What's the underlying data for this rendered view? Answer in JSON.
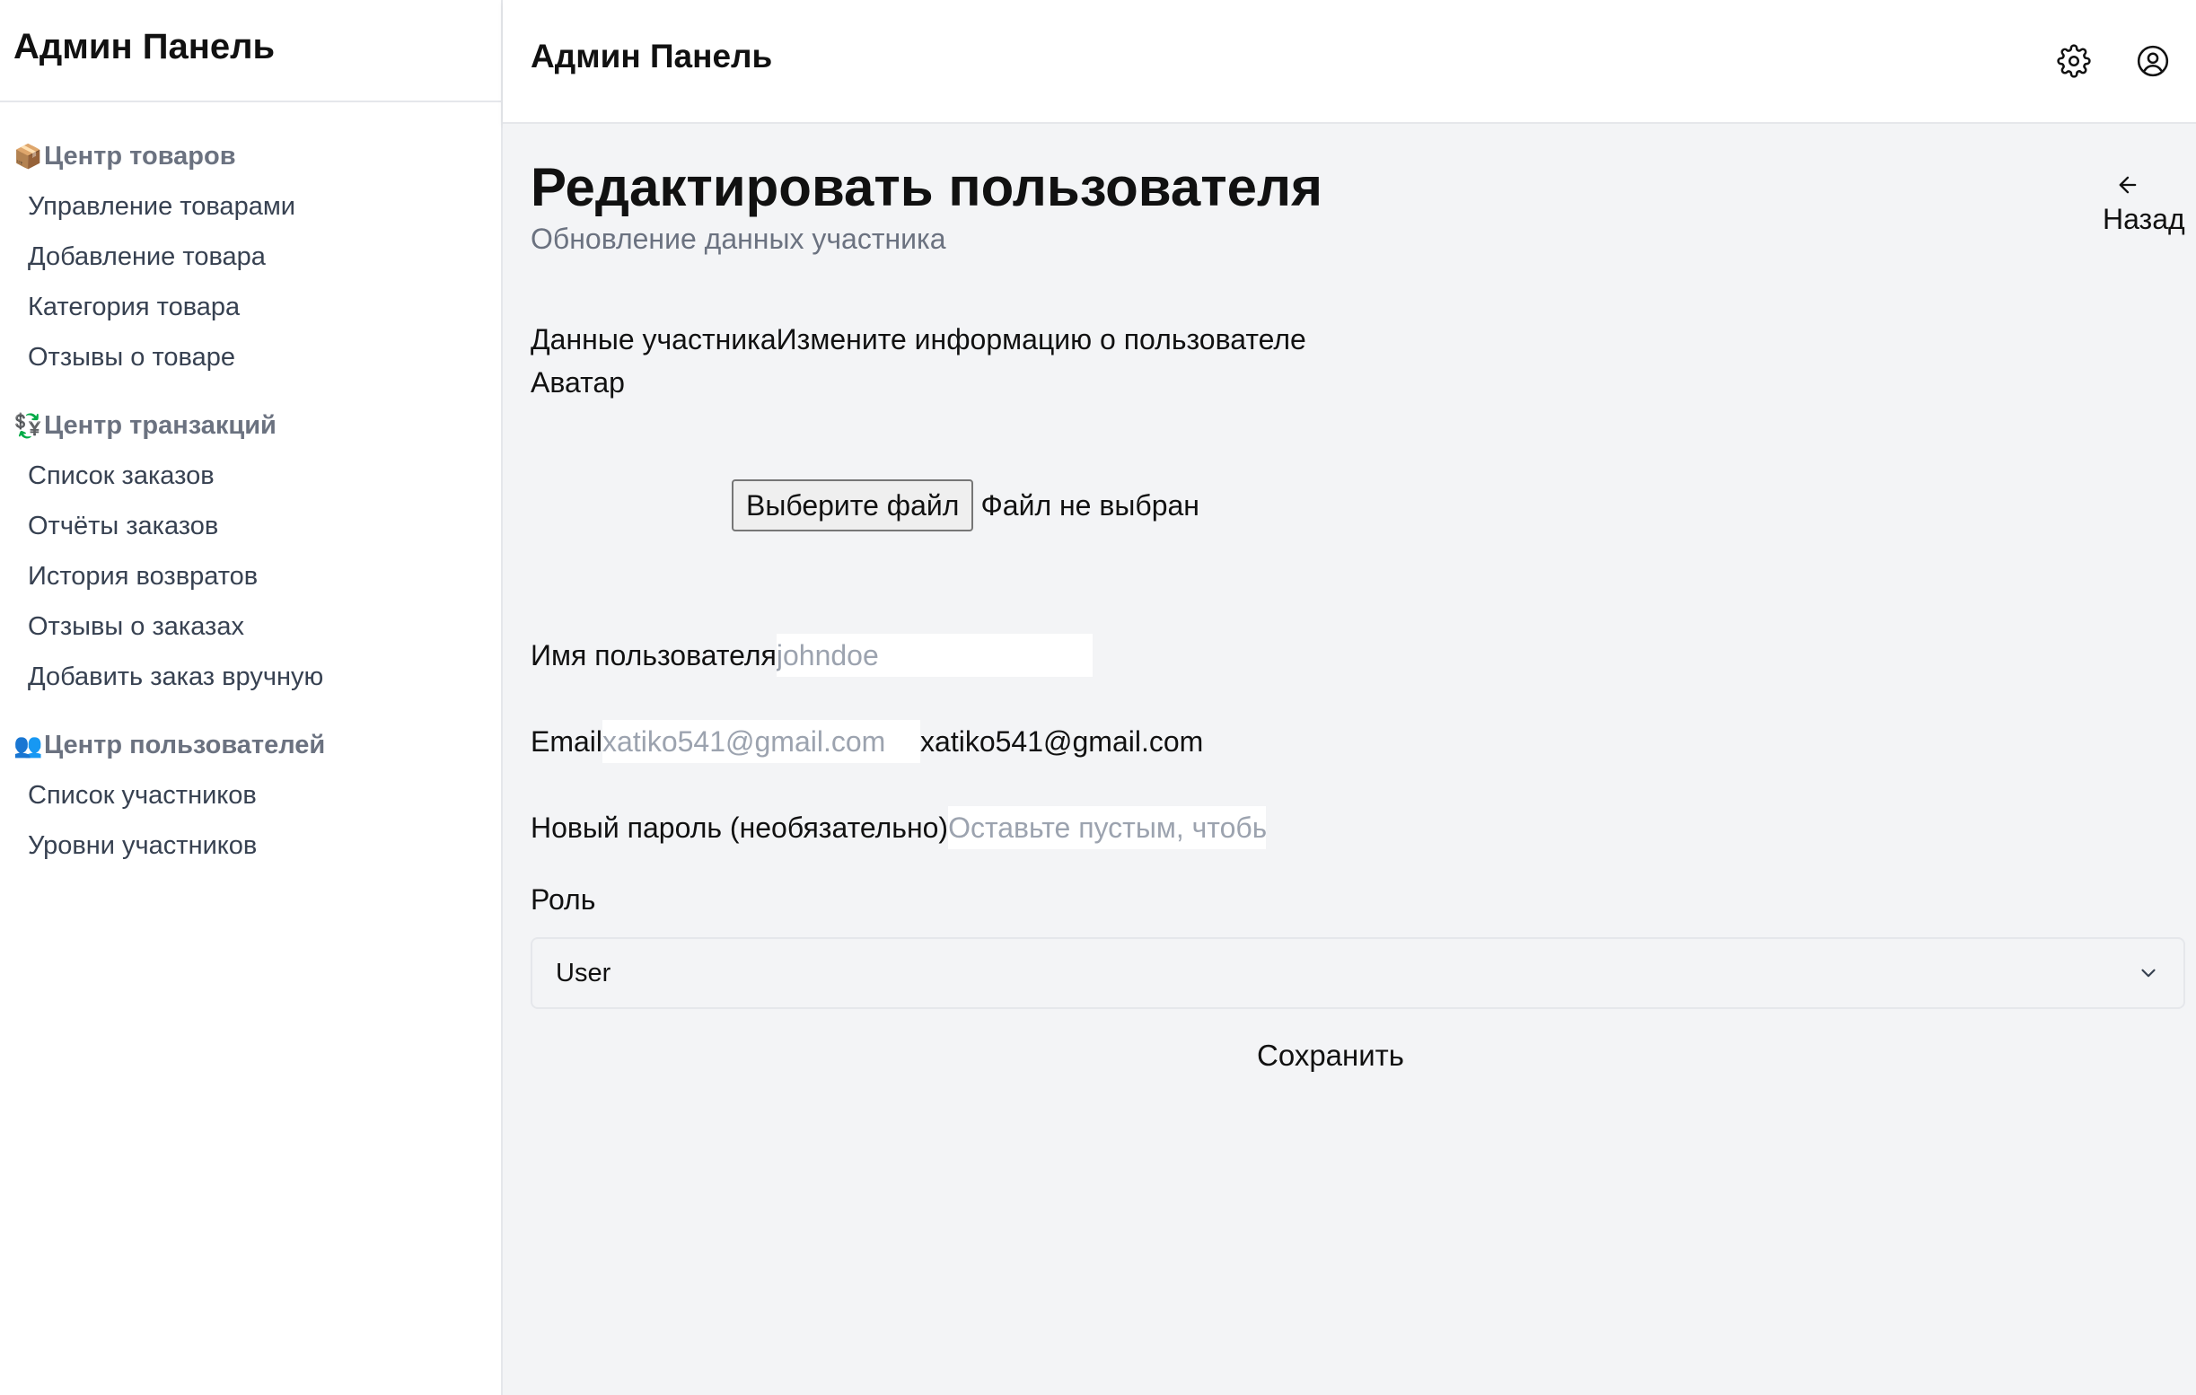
{
  "sidebar": {
    "title": "Админ Панель",
    "groups": [
      {
        "label": "Центр товаров",
        "icon": "📦",
        "items": [
          "Управление товарами",
          "Добавление товара",
          "Категория товара",
          "Отзывы о товаре"
        ]
      },
      {
        "label": "Центр транзакций",
        "icon": "💱",
        "items": [
          "Список заказов",
          "Отчёты заказов",
          "История возвратов",
          "Отзывы о заказах",
          "Добавить заказ вручную"
        ]
      },
      {
        "label": "Центр пользователей",
        "icon": "👥",
        "items": [
          "Список участников",
          "Уровни участников"
        ]
      }
    ]
  },
  "header": {
    "title": "Админ Панель",
    "settings_icon": "gear-icon",
    "account_icon": "user-circle-icon"
  },
  "page": {
    "title": "Редактировать пользователя",
    "subtitle": "Обновление данных участника",
    "back_label": "Назад"
  },
  "form": {
    "section_title": "Данные участника",
    "section_description": "Измените информацию о пользователе",
    "avatar_label": "Аватар",
    "file_button": "Выберите файл",
    "file_status": "Файл не выбран",
    "username_label": "Имя пользователя",
    "username_value": "",
    "username_placeholder": "johndoe",
    "email_label": "Email",
    "email_value": "",
    "email_placeholder": "xatiko541@gmail.com",
    "email_display": "xatiko541@gmail.com",
    "password_label": "Новый пароль (необязательно)",
    "password_value": "",
    "password_placeholder": "Оставьте пустым, чтобы",
    "role_label": "Роль",
    "role_value": "User",
    "save_label": "Сохранить"
  },
  "colors": {
    "main_background": "#f3f4f6",
    "muted_text": "#6b7280",
    "border": "#e5e7eb"
  }
}
